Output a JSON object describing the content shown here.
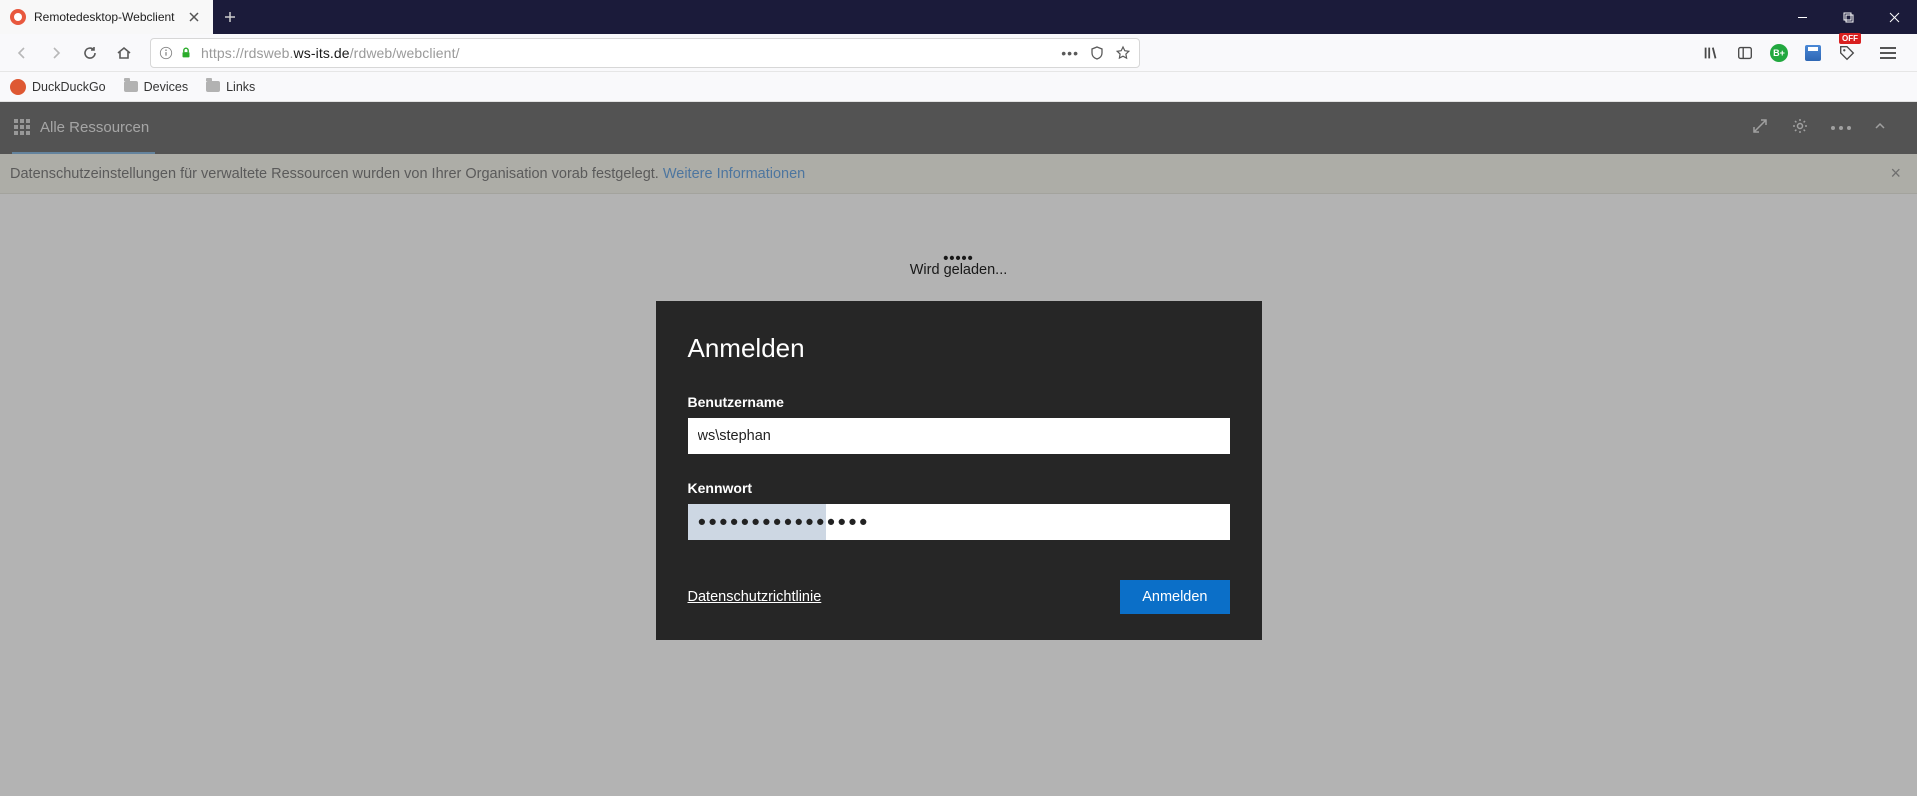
{
  "browser": {
    "tab_title": "Remotedesktop-Webclient",
    "url_prefix": "https://rdsweb.",
    "url_host": "ws-its.de",
    "url_path": "/rdweb/webclient/"
  },
  "bookmarks": [
    {
      "label": "DuckDuckGo"
    },
    {
      "label": "Devices"
    },
    {
      "label": "Links"
    }
  ],
  "ext": {
    "green_badge": "B+"
  },
  "app": {
    "tab_label": "Alle Ressourcen",
    "notice_text": "Datenschutzeinstellungen für verwaltete Ressourcen wurden von Ihrer Organisation vorab festgelegt.",
    "notice_link": "Weitere Informationen",
    "loading": "Wird geladen..."
  },
  "login": {
    "title": "Anmelden",
    "username_label": "Benutzername",
    "username_value": "ws\\stephan",
    "password_label": "Kennwort",
    "password_value": "●●●●●●●●●●●●●●●●",
    "privacy": "Datenschutzrichtlinie",
    "submit": "Anmelden"
  }
}
